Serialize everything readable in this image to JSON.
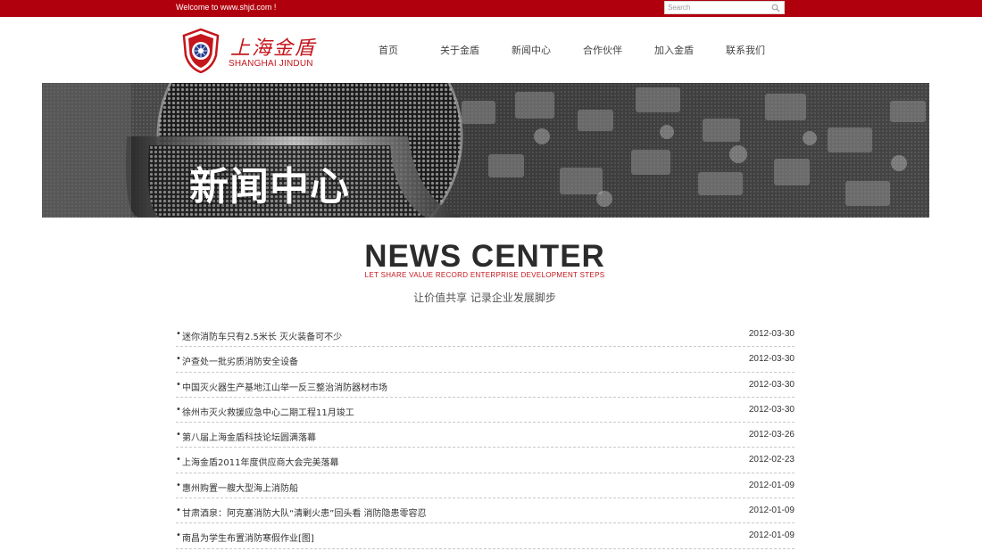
{
  "topbar": {
    "welcome": "Welcome to www.shjd.com !",
    "search_placeholder": "Search"
  },
  "logo": {
    "name_cn": "上海金盾",
    "name_en": "SHANGHAI  JINDUN"
  },
  "nav": {
    "items": [
      "首页",
      "关于金盾",
      "新闻中心",
      "合作伙伴",
      "加入金盾",
      "联系我们"
    ]
  },
  "banner": {
    "title": "新闻中心"
  },
  "section": {
    "heading": "NEWS CENTER",
    "subheading": "LET SHARE VALUE RECORD ENTERPRISE DEVELOPMENT STEPS",
    "subtitle_cn": "让价值共享 记录企业发展脚步"
  },
  "news": [
    {
      "title": "迷你消防车只有2.5米长 灭火装备可不少",
      "date": "2012-03-30"
    },
    {
      "title": "沪查处一批劣质消防安全设备",
      "date": "2012-03-30"
    },
    {
      "title": "中国灭火器生产基地江山举一反三整治消防器材市场",
      "date": "2012-03-30"
    },
    {
      "title": "徐州市灭火救援应急中心二期工程11月竣工",
      "date": "2012-03-30"
    },
    {
      "title": "第八届上海金盾科技论坛圆满落幕",
      "date": "2012-03-26"
    },
    {
      "title": "上海金盾2011年度供应商大会完美落幕",
      "date": "2012-02-23"
    },
    {
      "title": "惠州购置一艘大型海上消防船",
      "date": "2012-01-09"
    },
    {
      "title": "甘肃酒泉：阿克塞消防大队“清剿火患”回头看 消防隐患零容忍",
      "date": "2012-01-09"
    },
    {
      "title": "南昌为学生布置消防寒假作业[图]",
      "date": "2012-01-09"
    }
  ],
  "colors": {
    "brand_red": "#b1000d",
    "logo_red": "#c4161c"
  },
  "icons": {
    "search": "search-icon",
    "logo": "shield-logo-icon"
  }
}
